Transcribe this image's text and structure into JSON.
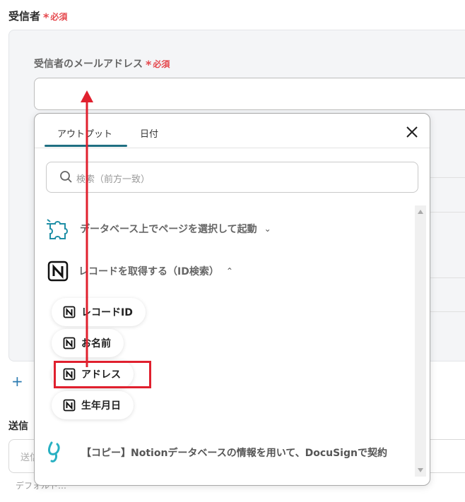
{
  "recipients": {
    "section_label": "受信者",
    "required_label": "必須",
    "email_label": "受信者のメールアドレス",
    "email_value": ""
  },
  "dropdown": {
    "tabs": [
      {
        "label": "アウトプット",
        "active": true
      },
      {
        "label": "日付",
        "active": false
      }
    ],
    "search_placeholder": "検索（前方一致）",
    "groups": [
      {
        "title": "データベース上でページを選択して起動",
        "icon": "puzzle-icon",
        "expanded": false
      },
      {
        "title": "レコードを取得する（ID検索）",
        "icon": "notion-icon",
        "expanded": true
      }
    ],
    "items": [
      {
        "label": "レコードID",
        "icon": "notion-icon"
      },
      {
        "label": "お名前",
        "icon": "notion-icon"
      },
      {
        "label": "アドレス",
        "icon": "notion-icon",
        "highlighted": true
      },
      {
        "label": "生年月日",
        "icon": "notion-icon"
      }
    ],
    "flow_title": "【コピー】Notionデータベースの情報を用いて、DocuSignで契約"
  },
  "sender": {
    "label": "送信",
    "input_value": "送信",
    "help_text": "デフォルト…"
  },
  "colors": {
    "accent": "#1f6f82",
    "required": "#e5484d",
    "annotation": "#e0202e"
  }
}
